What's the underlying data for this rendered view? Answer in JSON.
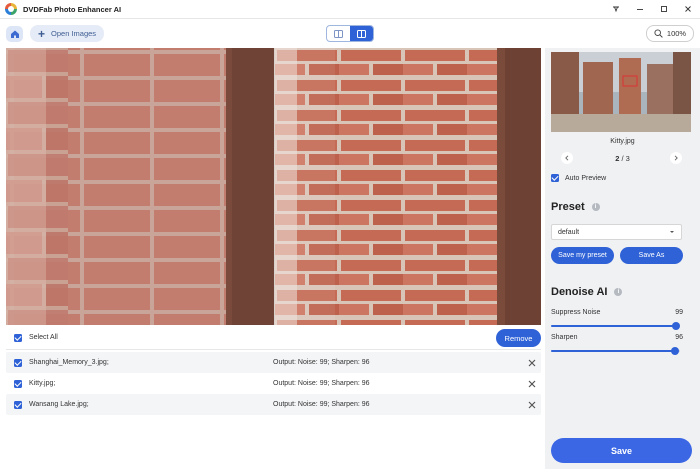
{
  "app": {
    "title": "DVDFab Photo Enhancer AI"
  },
  "window_controls": [
    "pin-icon",
    "minimize-icon",
    "maximize-icon",
    "close-icon"
  ],
  "toolbar": {
    "open_label": "Open Images",
    "zoom_level": "100%",
    "view_mode_selected": "side-by-side"
  },
  "file_list": {
    "select_all_label": "Select All",
    "remove_label": "Remove",
    "rows": [
      {
        "name": "Shanghai_Memory_3.jpg;",
        "output": "Output: Noise: 99; Sharpen: 96",
        "checked": true
      },
      {
        "name": "Kitty.jpg;",
        "output": "Output: Noise: 99; Sharpen: 96",
        "checked": true
      },
      {
        "name": "Wansang Lake.jpg;",
        "output": "Output: Noise: 99; Sharpen: 96",
        "checked": true
      }
    ]
  },
  "sidebar": {
    "thumb_name": "Kitty.jpg",
    "counter_current": "2",
    "counter_total": "/ 3",
    "auto_preview_label": "Auto Preview",
    "preset_title": "Preset",
    "preset_value": "default",
    "save_preset_label": "Save my preset",
    "save_as_label": "Save As",
    "denoise_title": "Denoise AI",
    "suppress_label": "Suppress Noise",
    "suppress_value": "99",
    "sharpen_label": "Sharpen",
    "sharpen_value": "96",
    "suppress_fraction": 0.99,
    "sharpen_fraction": 0.96,
    "save_label": "Save"
  },
  "colors": {
    "accent": "#2f62d7",
    "save_button": "#3b67e5",
    "sidebar_bg": "#f0f1f3"
  }
}
